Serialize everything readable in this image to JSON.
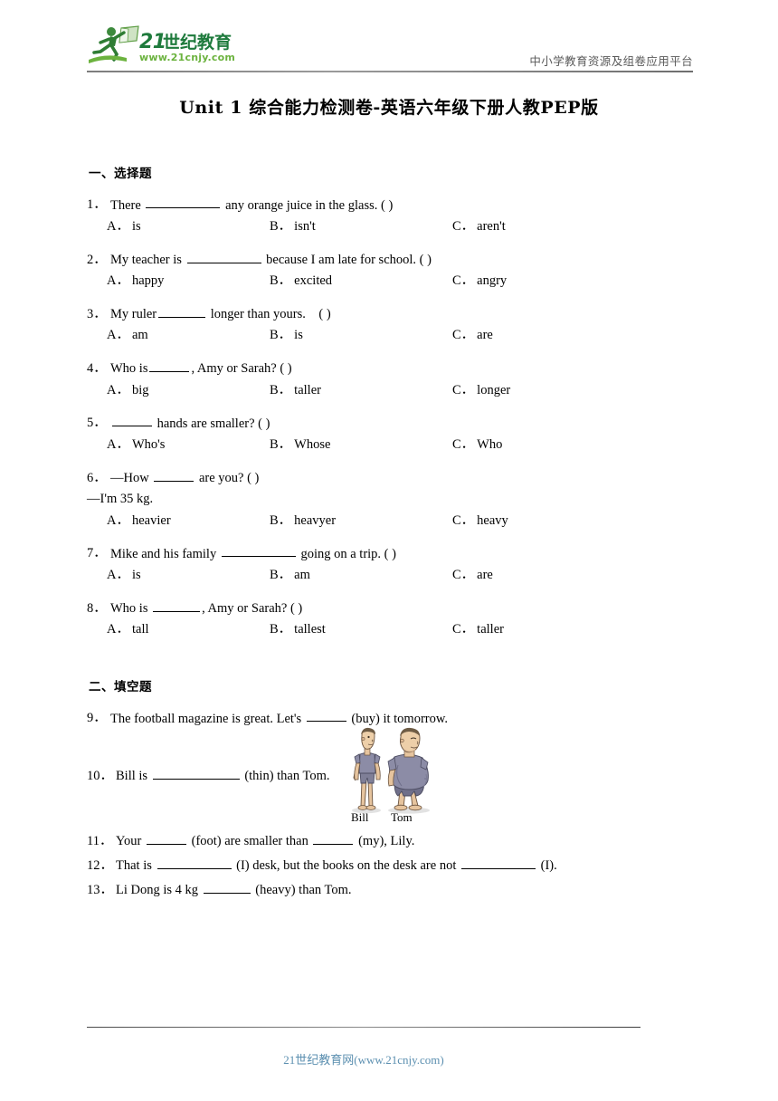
{
  "header": {
    "logo_text": "21世纪教育",
    "logo_url": "www.21cnjy.com",
    "tagline": "中小学教育资源及组卷应用平台"
  },
  "title": "Unit 1 综合能力检测卷-英语六年级下册人教PEP版",
  "sections": [
    {
      "heading": "一、选择题",
      "questions": [
        {
          "num": "1．",
          "pre": "There ",
          "post": " any orange juice in the glass. (    )",
          "options": [
            {
              "key": "A．",
              "text": "is"
            },
            {
              "key": "B．",
              "text": "isn't"
            },
            {
              "key": "C．",
              "text": "aren't"
            }
          ]
        },
        {
          "num": "2．",
          "pre": "My teacher is ",
          "post": " because I am late for school. (  )",
          "options": [
            {
              "key": "A．",
              "text": "happy"
            },
            {
              "key": "B．",
              "text": "excited"
            },
            {
              "key": "C．",
              "text": "angry"
            }
          ]
        },
        {
          "num": "3．",
          "pre": "My ruler",
          "post": " longer than yours.　(  )",
          "options": [
            {
              "key": "A．",
              "text": "am"
            },
            {
              "key": "B．",
              "text": "is"
            },
            {
              "key": "C．",
              "text": "are"
            }
          ]
        },
        {
          "num": "4．",
          "pre": "Who is",
          "post": ", Amy or Sarah? (   )",
          "options": [
            {
              "key": "A．",
              "text": "big"
            },
            {
              "key": "B．",
              "text": "taller"
            },
            {
              "key": "C．",
              "text": "longer"
            }
          ]
        },
        {
          "num": "5．",
          "pre": "",
          "post": " hands are smaller? (   )",
          "options": [
            {
              "key": "A．",
              "text": "Who's"
            },
            {
              "key": "B．",
              "text": "Whose"
            },
            {
              "key": "C．",
              "text": "Who"
            }
          ]
        },
        {
          "num": "6．",
          "pre": "—How ",
          "post": " are you? (   )",
          "answer_line": "—I'm 35 kg.",
          "options": [
            {
              "key": "A．",
              "text": "heavier"
            },
            {
              "key": "B．",
              "text": "heavyer"
            },
            {
              "key": "C．",
              "text": "heavy"
            }
          ]
        },
        {
          "num": "7．",
          "pre": "Mike and his family ",
          "post": " going on a trip. (  )",
          "options": [
            {
              "key": "A．",
              "text": "is"
            },
            {
              "key": "B．",
              "text": "am"
            },
            {
              "key": "C．",
              "text": "are"
            }
          ]
        },
        {
          "num": "8．",
          "pre": "Who is ",
          "post": ", Amy or Sarah? (   )",
          "options": [
            {
              "key": "A．",
              "text": "tall"
            },
            {
              "key": "B．",
              "text": "tallest"
            },
            {
              "key": "C．",
              "text": "taller"
            }
          ]
        }
      ]
    },
    {
      "heading": "二、填空题",
      "questions": [
        {
          "num": "9．",
          "pre": "The football magazine is great. Let's ",
          "post": " (buy) it tomorrow."
        },
        {
          "num": "10．",
          "pre": "Bill is ",
          "post": " (thin) than Tom."
        },
        {
          "num": "11．",
          "pre": "Your ",
          "mid": " (foot) are smaller than ",
          "post": " (my), Lily."
        },
        {
          "num": "12．",
          "pre": "That is ",
          "mid": " (I) desk, but the books on the desk are not ",
          "post": " (I)."
        },
        {
          "num": "13．",
          "pre": "Li Dong is 4 kg ",
          "post": " (heavy) than Tom."
        }
      ]
    }
  ],
  "figure": {
    "label_left": "Bill",
    "label_right": "Tom"
  },
  "footer": {
    "text": "21世纪教育网(www.21cnjy.com)"
  },
  "colors": {
    "logo_green_dark": "#1e7a3c",
    "logo_green_light": "#6cb33f",
    "footer_link": "#5b8fb0",
    "shirt": "#8a8aa5",
    "skin": "#e8c9a8"
  }
}
